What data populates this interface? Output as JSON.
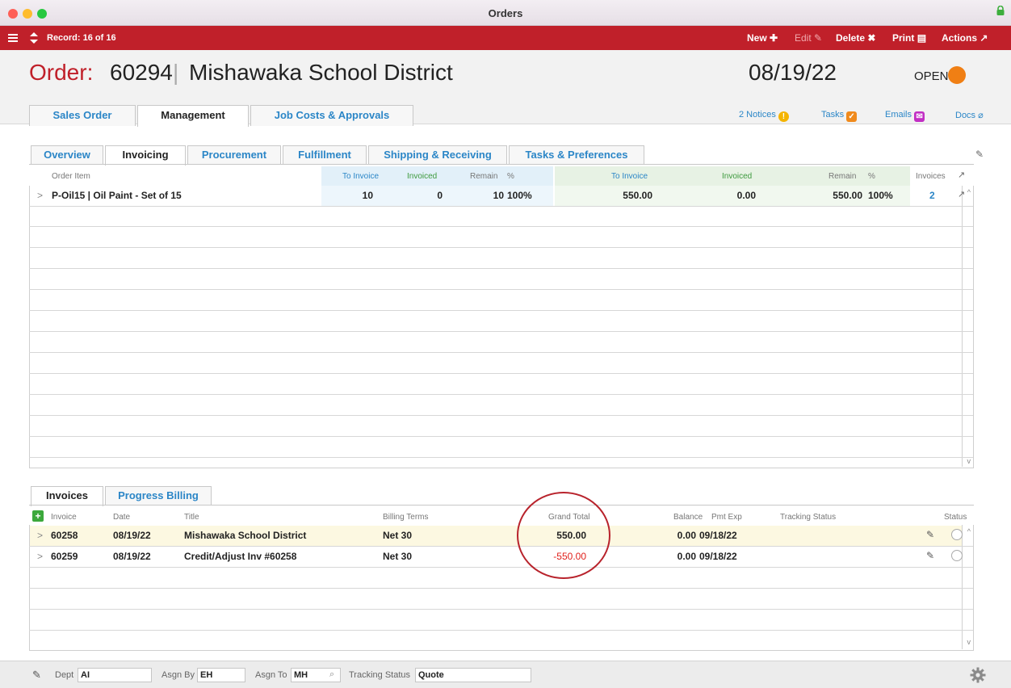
{
  "window": {
    "title": "Orders"
  },
  "toolbar": {
    "record": "Record: 16 of 16",
    "new": "New",
    "edit": "Edit",
    "delete": "Delete",
    "print": "Print",
    "actions": "Actions"
  },
  "header": {
    "order_label": "Order:",
    "order_number": "60294",
    "separator": "|",
    "customer": "Mishawaka School District",
    "date": "08/19/22",
    "status": "OPEN",
    "status_color": "#f07f14"
  },
  "main_tabs": [
    "Sales Order",
    "Management",
    "Job Costs & Approvals"
  ],
  "header_links": {
    "notices": "2 Notices",
    "tasks": "Tasks",
    "emails": "Emails",
    "docs": "Docs"
  },
  "sub_tabs": [
    "Overview",
    "Invoicing",
    "Procurement",
    "Fulfillment",
    "Shipping & Receiving",
    "Tasks & Preferences"
  ],
  "items_grid": {
    "headers": {
      "item": "Order Item",
      "qty_to_invoice": "To Invoice",
      "qty_invoiced": "Invoiced",
      "qty_remain": "Remain",
      "qty_pct": "%",
      "amt_to_invoice": "To Invoice",
      "amt_invoiced": "Invoiced",
      "amt_remain": "Remain",
      "amt_pct": "%",
      "invoices": "Invoices"
    },
    "rows": [
      {
        "expander": ">",
        "item": "P-Oil15 | Oil Paint - Set of 15",
        "qty_to_invoice": "10",
        "qty_invoiced": "0",
        "qty_remain": "10",
        "qty_pct": "100%",
        "amt_to_invoice": "550.00",
        "amt_invoiced": "0.00",
        "amt_remain": "550.00",
        "amt_pct": "100%",
        "invoices": "2"
      }
    ]
  },
  "bottom_tabs": [
    "Invoices",
    "Progress Billing"
  ],
  "invoices_grid": {
    "headers": {
      "invoice": "Invoice",
      "date": "Date",
      "title": "Title",
      "terms": "Billing Terms",
      "grand_total": "Grand Total",
      "balance": "Balance",
      "pmt_exp": "Pmt Exp",
      "tracking": "Tracking Status",
      "status": "Status"
    },
    "rows": [
      {
        "expander": ">",
        "invoice": "60258",
        "date": "08/19/22",
        "title": "Mishawaka School District",
        "terms": "Net 30",
        "grand_total": "550.00",
        "balance": "0.00",
        "pmt_exp": "09/18/22",
        "tracking": ""
      },
      {
        "expander": ">",
        "invoice": "60259",
        "date": "08/19/22",
        "title": "Credit/Adjust Inv #60258",
        "terms": "Net 30",
        "grand_total": "-550.00",
        "balance": "0.00",
        "pmt_exp": "09/18/22",
        "tracking": ""
      }
    ]
  },
  "footer": {
    "dept_label": "Dept",
    "dept_value": "AI",
    "asgn_by_label": "Asgn By",
    "asgn_by_value": "EH",
    "asgn_to_label": "Asgn To",
    "asgn_to_value": "MH",
    "tracking_label": "Tracking Status",
    "tracking_value": "Quote"
  },
  "colors": {
    "brand_red": "#c0202a",
    "link_blue": "#2b86c7",
    "negative_red": "#e0201b",
    "annotation_circle": "#b8232c"
  }
}
